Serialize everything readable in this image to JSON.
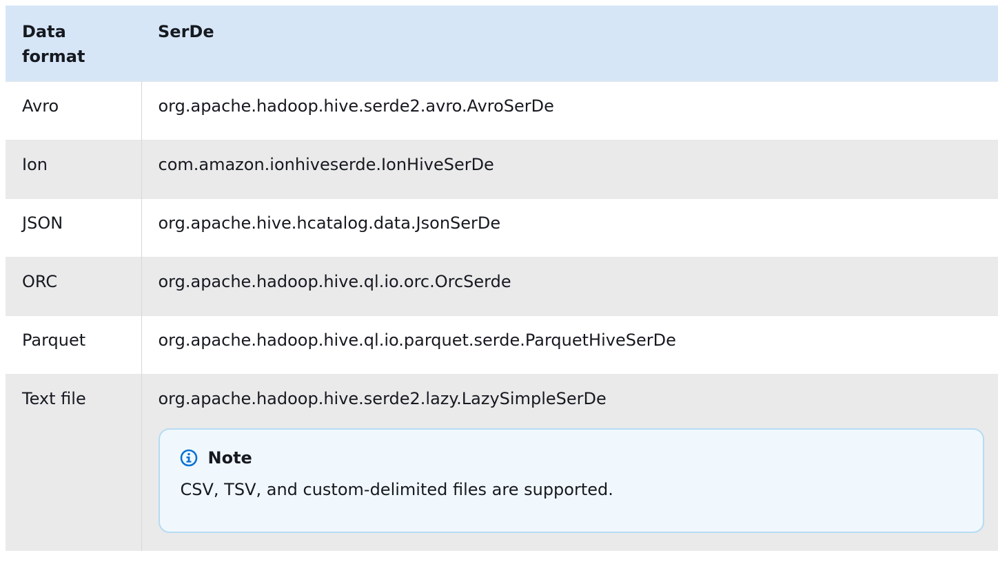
{
  "table": {
    "headers": [
      "Data format",
      "SerDe"
    ],
    "rows": [
      {
        "format": "Avro",
        "serde": "org.apache.hadoop.hive.serde2.avro.AvroSerDe"
      },
      {
        "format": "Ion",
        "serde": "com.amazon.ionhiveserde.IonHiveSerDe"
      },
      {
        "format": "JSON",
        "serde": "org.apache.hive.hcatalog.data.JsonSerDe"
      },
      {
        "format": "ORC",
        "serde": "org.apache.hadoop.hive.ql.io.orc.OrcSerde"
      },
      {
        "format": "Parquet",
        "serde": "org.apache.hadoop.hive.ql.io.parquet.serde.ParquetHiveSerDe"
      },
      {
        "format": "Text file",
        "serde": "org.apache.hadoop.hive.serde2.lazy.LazySimpleSerDe"
      }
    ]
  },
  "note": {
    "icon": "info-icon",
    "title": "Note",
    "text": "CSV, TSV, and custom-delimited files are supported."
  },
  "colors": {
    "header_bg": "#d6e6f7",
    "row_alt_bg": "#eaeaeb",
    "note_bg": "#f0f8fd",
    "note_border": "#b6dbf2",
    "info_icon": "#0972d3"
  }
}
